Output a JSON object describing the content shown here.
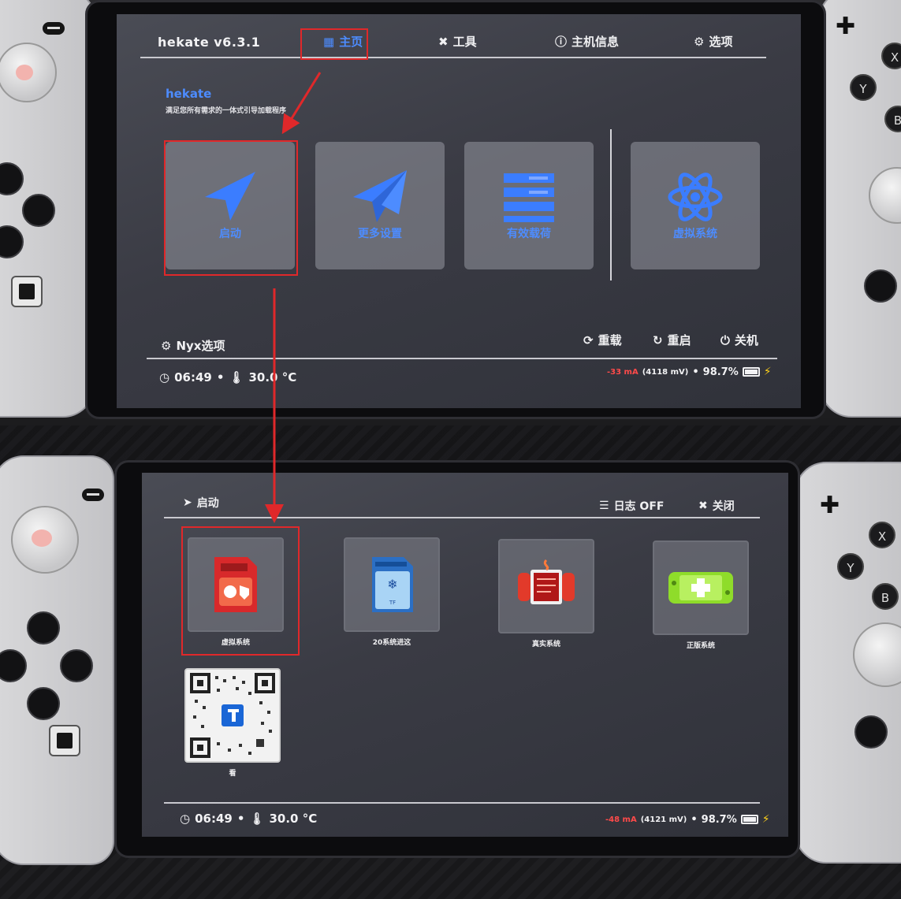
{
  "top_screen": {
    "app_title": "hekate v6.3.1",
    "tabs": [
      {
        "label": "主页",
        "icon": "grid-icon",
        "active": true
      },
      {
        "label": "工具",
        "icon": "tools-icon",
        "active": false
      },
      {
        "label": "主机信息",
        "icon": "info-icon",
        "active": false
      },
      {
        "label": "选项",
        "icon": "gear-icon",
        "active": false
      }
    ],
    "subtitle": "hekate",
    "description": "满足您所有需求的一体式引导加载程序",
    "tiles": [
      {
        "label": "启动",
        "icon": "launch-arrow-icon"
      },
      {
        "label": "更多设置",
        "icon": "paper-plane-icon"
      },
      {
        "label": "有效载荷",
        "icon": "payload-list-icon"
      },
      {
        "label": "虚拟系统",
        "icon": "atom-icon"
      }
    ],
    "nyx_options": "Nyx选项",
    "actions": {
      "reload": "重载",
      "reboot": "重启",
      "power_off": "关机"
    },
    "status": {
      "time": "06:49",
      "temperature": "30.0 °C",
      "current": "-33 mA",
      "voltage": "(4118 mV)",
      "battery": "98.7%"
    }
  },
  "bottom_screen": {
    "title": "启动",
    "actions": {
      "log": "日志 OFF",
      "close": "关闭"
    },
    "entries": [
      {
        "caption": "虚拟系统",
        "icon": "sd-card-shield-icon"
      },
      {
        "caption": "20系统进这",
        "icon": "switch-sd-card-icon"
      },
      {
        "caption": "真实系统",
        "icon": "switch-circuit-icon"
      },
      {
        "caption": "正版系统",
        "icon": "green-switch-icon"
      },
      {
        "caption": "看",
        "icon": "qr-code-icon"
      }
    ],
    "status": {
      "time": "06:49",
      "temperature": "30.0 °C",
      "current": "-48 mA",
      "voltage": "(4121 mV)",
      "battery": "98.7%"
    }
  },
  "colors": {
    "accent_blue": "#4d8cff",
    "highlight_red": "#e0282a",
    "screen_bg": "#3a3b44",
    "bolt_yellow": "#ffd21a"
  },
  "annotation_bullets": "• •"
}
